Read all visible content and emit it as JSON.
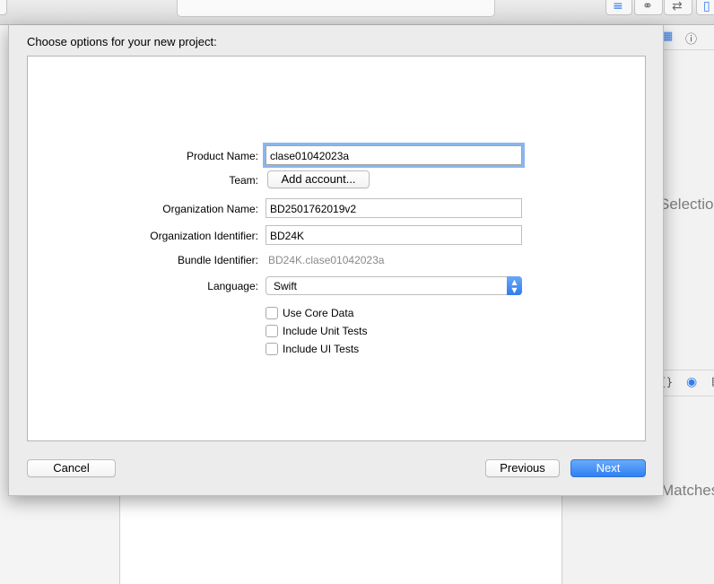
{
  "background": {
    "inspector": {
      "selection_text": "Selection",
      "matches_text": "Matches"
    }
  },
  "dialog": {
    "title": "Choose options for your new project:",
    "form": {
      "product_name_label": "Product Name:",
      "product_name_value": "clase01042023a",
      "team_label": "Team:",
      "team_button": "Add account...",
      "org_name_label": "Organization Name:",
      "org_name_value": "BD2501762019v2",
      "org_id_label": "Organization Identifier:",
      "org_id_value": "BD24K",
      "bundle_id_label": "Bundle Identifier:",
      "bundle_id_value": "BD24K.clase01042023a",
      "language_label": "Language:",
      "language_value": "Swift",
      "checkboxes": [
        {
          "label": "Use Core Data",
          "checked": false
        },
        {
          "label": "Include Unit Tests",
          "checked": false
        },
        {
          "label": "Include UI Tests",
          "checked": false
        }
      ]
    },
    "buttons": {
      "cancel": "Cancel",
      "previous": "Previous",
      "next": "Next"
    }
  },
  "colors": {
    "accent": "#2f80f3",
    "focus_ring": "#89b6ef"
  }
}
